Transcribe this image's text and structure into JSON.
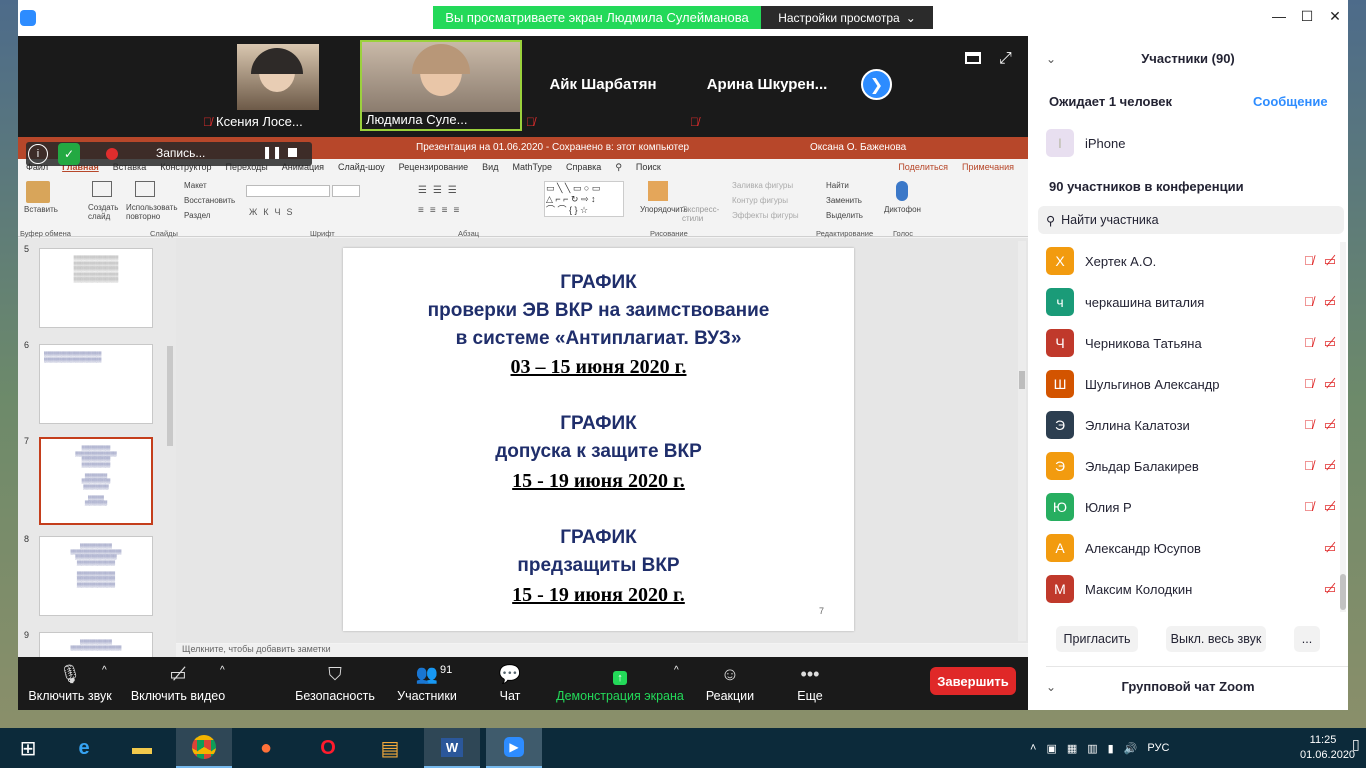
{
  "titlebar": {
    "viewing_banner": "Вы просматриваете экран Людмила Сулейманова",
    "view_settings": "Настройки просмотра"
  },
  "tiles": [
    {
      "name": "Ксения  Лосе..."
    },
    {
      "name": "Людмила Суле..."
    },
    {
      "name": "Айк Шарбатян"
    },
    {
      "name": "Арина  Шкурен..."
    }
  ],
  "ppt": {
    "title": "Презентация на 01.06.2020  -  Сохранено в: этот компьютер",
    "user": "Оксана О. Баженова",
    "menu": [
      "Файл",
      "Главная",
      "Вставка",
      "Конструктор",
      "Переходы",
      "Анимация",
      "Слайд-шоу",
      "Рецензирование",
      "Вид",
      "MathType",
      "Справка",
      "Поиск"
    ],
    "share": "Поделиться",
    "comments": "Примечания",
    "ribbon": {
      "paste": "Вставить",
      "create_slide": "Создать слайд",
      "reuse": "Использовать повторно",
      "layout": "Макет",
      "restore": "Восстановить",
      "section": "Раздел",
      "arrange": "Упорядочить",
      "express": "Экспресс-стили",
      "fill": "Заливка фигуры",
      "outline": "Контур фигуры",
      "effects": "Эффекты фигуры",
      "find": "Найти",
      "replace": "Заменить",
      "select": "Выделить",
      "dictation": "Диктофон"
    },
    "groups": [
      "Буфер обмена",
      "Слайды",
      "Шрифт",
      "Абзац",
      "Рисование",
      "Редактирование",
      "Голос"
    ],
    "thumb_numbers": [
      "5",
      "6",
      "7",
      "8",
      "9"
    ],
    "slide": {
      "h1": "ГРАФИК",
      "h1b": "проверки ЭВ ВКР на заимствование",
      "h1c": "в системе «Антиплагиат. ВУЗ»",
      "d1": "03 – 15 июня 2020 г.",
      "h2": "ГРАФИК",
      "h2b": "допуска к защите ВКР",
      "d2": "15 - 19 июня 2020 г.",
      "h3": "ГРАФИК",
      "h3b": "предзащиты ВКР",
      "d3": "15 - 19 июня 2020 г.",
      "num": "7"
    },
    "notes": "Щелкните, чтобы добавить заметки"
  },
  "recording": {
    "label": "Запись..."
  },
  "toolbar": {
    "unmute": "Включить звук",
    "video": "Включить видео",
    "security": "Безопасность",
    "participants": "Участники",
    "participants_count": "91",
    "chat": "Чат",
    "share": "Демонстрация экрана",
    "reactions": "Реакции",
    "more": "Еще",
    "end": "Завершить"
  },
  "panel": {
    "title": "Участники (90)",
    "waiting": "Ожидает 1 человек",
    "message": "Сообщение",
    "waiting_name": "iPhone",
    "waiting_initial": "I",
    "in_meeting": "90 участников в конференции",
    "search_placeholder": "Найти участника",
    "participants": [
      {
        "initial": "Х",
        "name": "Хертек А.О.",
        "color": "#f29b0f",
        "mic": true
      },
      {
        "initial": "ч",
        "name": "черкашина виталия",
        "color": "#1a9b78",
        "mic": true
      },
      {
        "initial": "Ч",
        "name": "Черникова Татьяна",
        "color": "#c0392b",
        "mic": true
      },
      {
        "initial": "Ш",
        "name": "Шульгинов Александр",
        "color": "#d35400",
        "mic": true
      },
      {
        "initial": "Э",
        "name": "Эллина Калатози",
        "color": "#2c3e50",
        "mic": true
      },
      {
        "initial": "Э",
        "name": "Эльдар Балакирев",
        "color": "#f29b0f",
        "mic": true
      },
      {
        "initial": "Ю",
        "name": "Юлия Р",
        "color": "#27ae60",
        "mic": true
      },
      {
        "initial": "А",
        "name": "Александр Юсупов",
        "color": "#f29b0f",
        "mic": false
      },
      {
        "initial": "М",
        "name": "Максим Колодкин",
        "color": "#c0392b",
        "mic": false
      }
    ],
    "invite": "Пригласить",
    "mute_all": "Выкл. весь звук",
    "more": "...",
    "group_chat": "Групповой чат Zoom"
  },
  "taskbar": {
    "lang": "РУС",
    "time": "11:25",
    "date": "01.06.2020"
  },
  "colors": {
    "zoom_blue": "#2d8cff",
    "ppt_red": "#b7472a",
    "share_green": "#23d959",
    "end_red": "#e02828"
  }
}
